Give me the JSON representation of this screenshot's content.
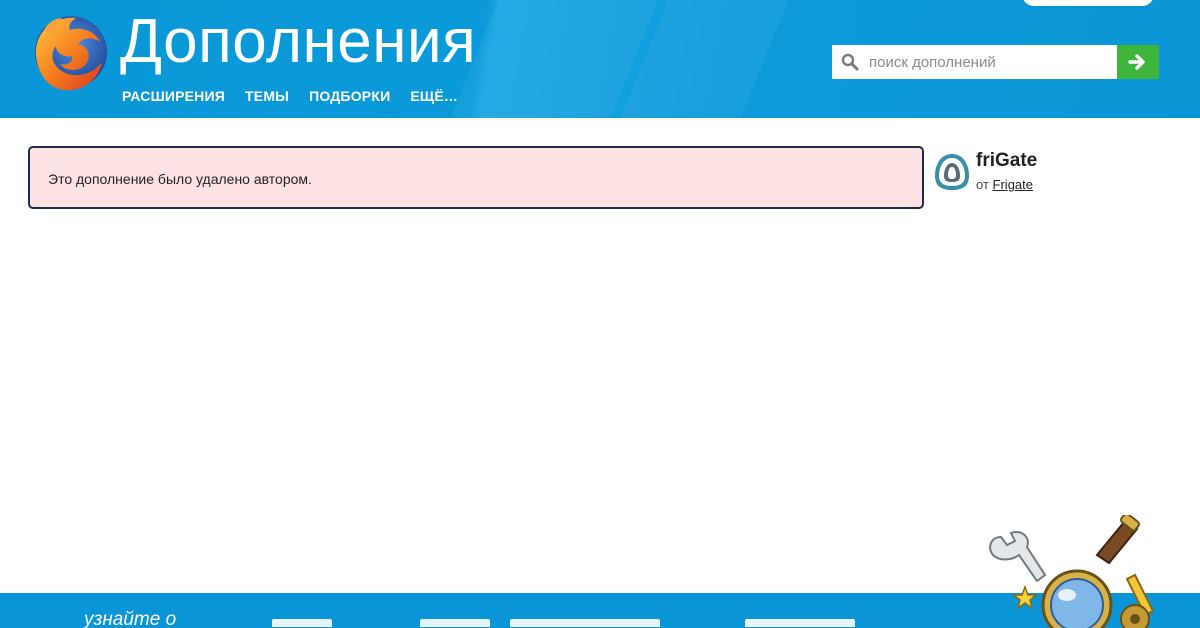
{
  "header": {
    "title": "Дополнения",
    "nav": [
      "РАСШИРЕНИЯ",
      "ТЕМЫ",
      "ПОДБОРКИ",
      "ЕЩЁ…"
    ],
    "search_placeholder": "поиск дополнений",
    "search_value": ""
  },
  "notice": {
    "text": "Это дополнение было удалено автором."
  },
  "addon": {
    "name": "friGate",
    "by_prefix": "от",
    "author": "Frigate"
  },
  "footer": {
    "learn_text": "узнайте о"
  },
  "colors": {
    "header_blue": "#0a96d6",
    "search_go_green": "#3fb63b",
    "notice_bg": "#fde2e4",
    "notice_border": "#1e2b4a"
  },
  "icons": [
    "firefox-logo",
    "search-icon",
    "arrow-right-icon",
    "frigate-addon-icon",
    "tools-mascot-illustration"
  ]
}
